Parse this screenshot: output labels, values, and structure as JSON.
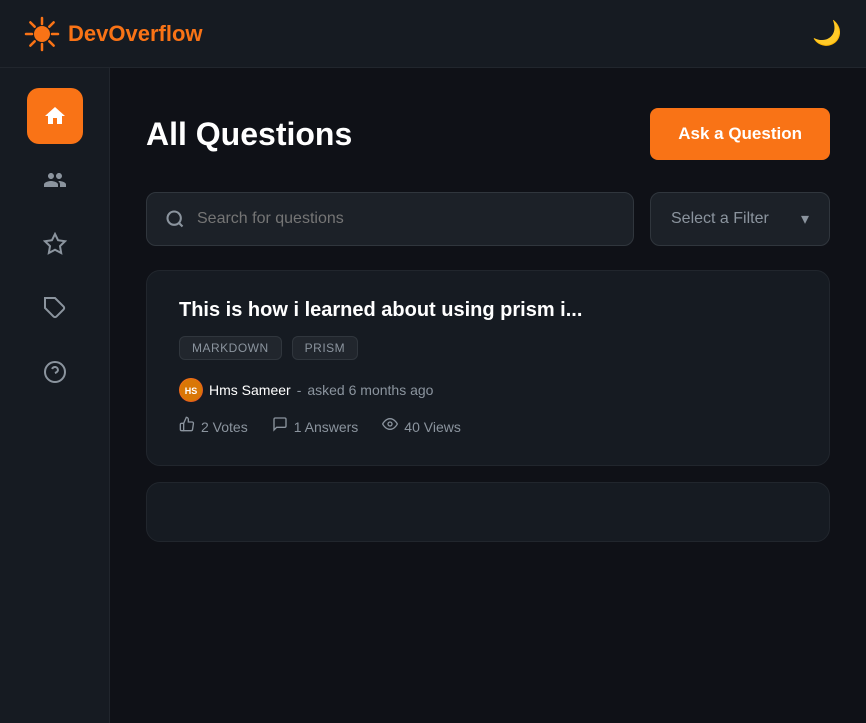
{
  "header": {
    "logo_text_plain": "Dev",
    "logo_text_colored": "Overflow",
    "moon_icon": "🌙"
  },
  "sidebar": {
    "items": [
      {
        "id": "home",
        "icon": "⌂",
        "active": true
      },
      {
        "id": "community",
        "icon": "👥",
        "active": false
      },
      {
        "id": "starred",
        "icon": "☆",
        "active": false
      },
      {
        "id": "tags",
        "icon": "🏷",
        "active": false
      },
      {
        "id": "help",
        "icon": "?",
        "active": false
      }
    ]
  },
  "main": {
    "page_title": "All Questions",
    "ask_button_label": "Ask a Question",
    "search": {
      "placeholder": "Search for questions"
    },
    "filter": {
      "label": "Select a Filter"
    },
    "questions": [
      {
        "title": "This is how i learned about using prism i...",
        "tags": [
          "MARKDOWN",
          "PRISM"
        ],
        "author": "Hms Sameer",
        "author_initials": "HS",
        "time": "asked 6 months ago",
        "votes": "2 Votes",
        "answers": "1 Answers",
        "views": "40 Views"
      }
    ]
  }
}
